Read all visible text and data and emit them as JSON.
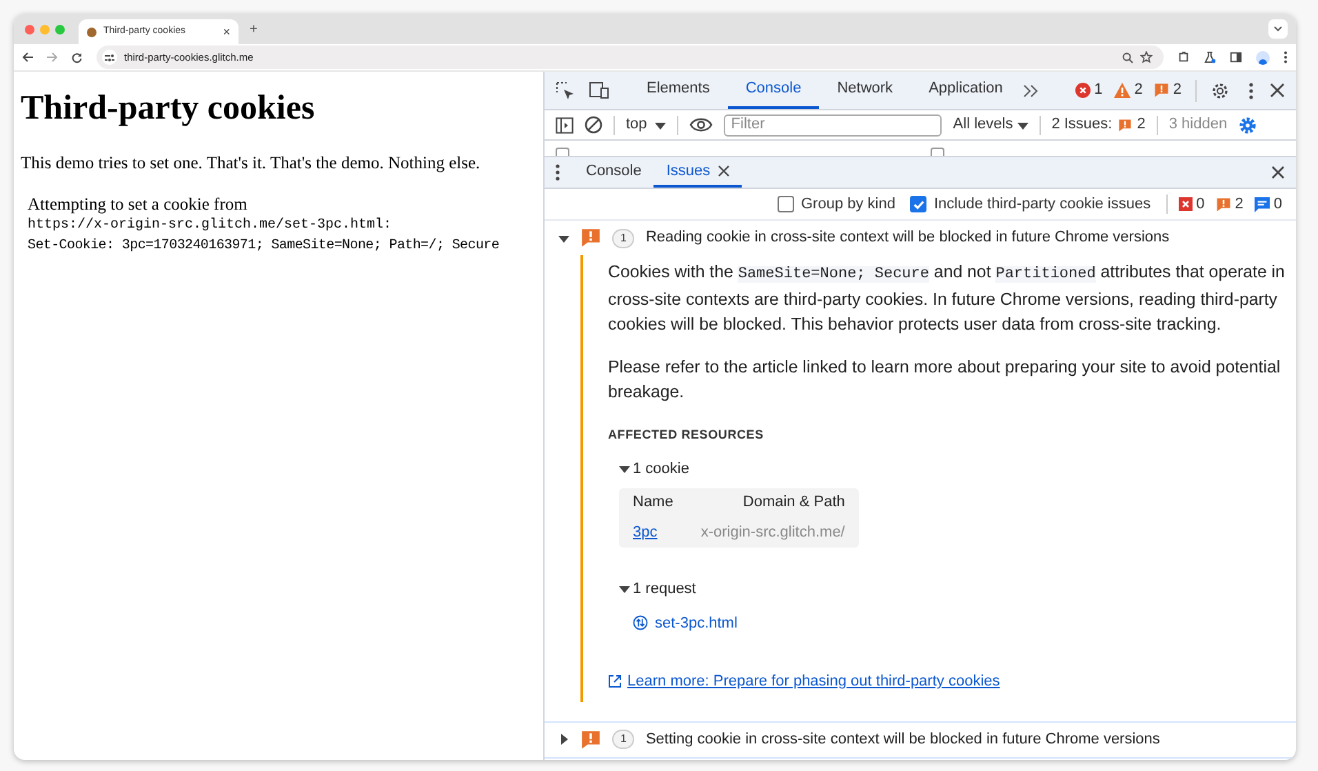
{
  "browser": {
    "tab_title": "Third-party cookies",
    "tab_close": "×",
    "new_tab": "+",
    "url": "third-party-cookies.glitch.me"
  },
  "page": {
    "heading": "Third-party cookies",
    "paragraph": "This demo tries to set one. That's it. That's the demo. Nothing else.",
    "attempt_text": "Attempting to set a cookie from",
    "attempt_url": "https://x-origin-src.glitch.me/set-3pc.html:",
    "set_cookie": "Set-Cookie: 3pc=1703240163971; SameSite=None; Path=/; Secure"
  },
  "devtools": {
    "panels": [
      {
        "label": "Elements",
        "selected": false
      },
      {
        "label": "Console",
        "selected": true
      },
      {
        "label": "Network",
        "selected": false
      },
      {
        "label": "Application",
        "selected": false
      }
    ],
    "counts": [
      {
        "kind": "error",
        "count": "1"
      },
      {
        "kind": "warning",
        "count": "2"
      },
      {
        "kind": "issue",
        "count": "2"
      }
    ]
  },
  "console_toolbar": {
    "context": "top",
    "filter_placeholder": "Filter",
    "levels": "All levels",
    "issues_label": "2 Issues:",
    "issues_count": "2",
    "hidden": "3 hidden"
  },
  "partial_row_checkboxes": [
    {
      "checked": false
    },
    {
      "checked": false
    }
  ],
  "drawer_tabs": [
    {
      "label": "Console",
      "selected": false,
      "closable": false
    },
    {
      "label": "Issues",
      "selected": true,
      "closable": true
    }
  ],
  "issues_toolbar": {
    "options": [
      {
        "label": "Group by kind",
        "checked": false
      },
      {
        "label": "Include third-party cookie issues",
        "checked": true
      }
    ],
    "counts": [
      {
        "kind": "error",
        "count": "0"
      },
      {
        "kind": "issue",
        "count": "2"
      },
      {
        "kind": "info",
        "count": "0"
      }
    ]
  },
  "issues": [
    {
      "count": "1",
      "title": "Reading cookie in cross-site context will be blocked in future Chrome versions",
      "expanded": true,
      "description": [
        {
          "kind": "text",
          "text": "Cookies with the "
        },
        {
          "kind": "code",
          "text": "SameSite=None; Secure"
        },
        {
          "kind": "text",
          "text": " and not "
        },
        {
          "kind": "code",
          "text": "Partitioned"
        },
        {
          "kind": "text",
          "text": " attributes that operate in cross-site contexts are third-party cookies. In future Chrome versions, reading third-party cookies will be blocked. This behavior protects user data from cross-site tracking."
        }
      ],
      "note": "Please refer to the article linked to learn more about preparing your site to avoid potential breakage.",
      "affected_heading": "AFFECTED RESOURCES",
      "cookies": {
        "label": "1 cookie",
        "expanded": true,
        "columns": [
          "Name",
          "Domain & Path"
        ],
        "rows": [
          [
            "3pc",
            "x-origin-src.glitch.me/"
          ]
        ]
      },
      "requests": {
        "label": "1 request",
        "expanded": true,
        "items": [
          "set-3pc.html"
        ]
      },
      "learn_more": "Learn more: Prepare for phasing out third-party cookies"
    },
    {
      "count": "1",
      "title": "Setting cookie in cross-site context will be blocked in future Chrome versions",
      "expanded": false
    }
  ]
}
